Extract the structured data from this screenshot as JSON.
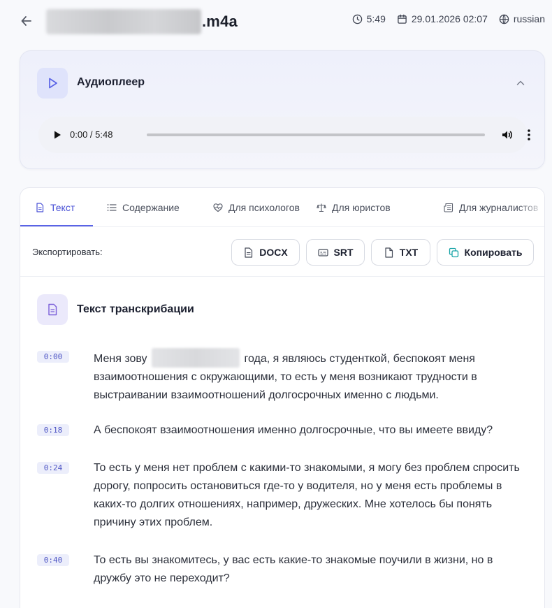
{
  "header": {
    "file_ext": ".m4a",
    "duration": "5:49",
    "datetime": "29.01.2026 02:07",
    "language": "russian"
  },
  "audio_player": {
    "title": "Аудиоплеер",
    "time": "0:00 / 5:48",
    "progress_fraction": 0
  },
  "tabs": [
    {
      "label": "Текст",
      "icon": "document-icon",
      "active": true
    },
    {
      "label": "Содержание",
      "icon": "list-icon",
      "active": false
    },
    {
      "label": "Для психологов",
      "icon": "heart-pulse-icon",
      "active": false
    },
    {
      "label": "Для юристов",
      "icon": "scales-icon",
      "active": false
    },
    {
      "label": "Для журналистов",
      "icon": "newspaper-icon",
      "active": false
    }
  ],
  "export": {
    "label": "Экспортировать:",
    "buttons": [
      {
        "label": "DOCX",
        "icon": "document-icon"
      },
      {
        "label": "SRT",
        "icon": "subtitles-icon"
      },
      {
        "label": "TXT",
        "icon": "file-icon"
      },
      {
        "label": "Копировать",
        "icon": "copy-icon"
      }
    ]
  },
  "transcript": {
    "title": "Текст транскрибации",
    "segments": [
      {
        "time": "0:00",
        "text_before": "Меня зову",
        "text_after": "года, я являюсь студенткой, беспокоят меня взаимоотношения с окружающими, то есть у меня возникают трудности в выстраивании взаимоотношений долгосрочных именно с людьми."
      },
      {
        "time": "0:18",
        "text": "А беспокоят взаимоотношения именно долгосрочные, что вы имеете ввиду?"
      },
      {
        "time": "0:24",
        "text": "То есть у меня нет проблем с какими-то знакомыми, я могу без проблем спросить дорогу, попросить остановиться где-то у водителя, но у меня есть проблемы в каких-то долгих отношениях, например, дружеских. Мне хотелось бы понять причину этих проблем."
      },
      {
        "time": "0:40",
        "text": "То есть вы знакомитесь, у вас есть какие-то знакомые поучили в жизни, но в дружбу это не переходит?"
      }
    ]
  },
  "colors": {
    "accent": "#5a63e6",
    "timestamp_bg": "#eceefb",
    "timestamp_text": "#4f56c4"
  }
}
